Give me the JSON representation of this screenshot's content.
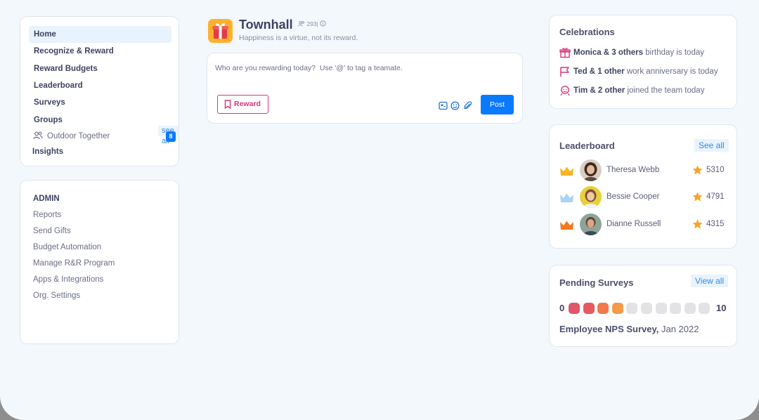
{
  "nav": {
    "items": [
      {
        "label": "Home",
        "active": true
      },
      {
        "label": "Recognize & Reward"
      },
      {
        "label": "Reward Budgets"
      },
      {
        "label": "Leaderboard"
      },
      {
        "label": "Surveys"
      },
      {
        "label": "Groups"
      }
    ],
    "groups_see_all": "see all",
    "group": {
      "label": "Outdoor Together",
      "count": "8"
    },
    "insights": "Insights"
  },
  "admin": {
    "title": "ADMIN",
    "links": [
      "Reports",
      "Send Gifts",
      "Budget Automation",
      "Manage R&R Program",
      "Apps & Integrations",
      "Org. Settings"
    ]
  },
  "townhall": {
    "title": "Townhall",
    "members": "293",
    "info_sep": "|",
    "subtitle": "Happiness is a virtue, not its reward."
  },
  "composer": {
    "placeholder": "Who are you rewarding today?  Use '@' to tag a teamate.",
    "reward_label": "Reward",
    "post_label": "Post",
    "tools": [
      "gif-icon",
      "emoji-icon",
      "attachment-icon"
    ]
  },
  "celebrations": {
    "title": "Celebrations",
    "items": [
      {
        "icon": "gift-icon",
        "who": "Monica & 3 others",
        "what": " birthday is today"
      },
      {
        "icon": "flag-icon",
        "who": "Ted & 1 other",
        "what": " work anniversary is today"
      },
      {
        "icon": "welcome-icon",
        "who": "Tim & 2 other",
        "what": " joined the team today"
      }
    ]
  },
  "leaderboard": {
    "title": "Leaderboard",
    "see_all": "See all",
    "entries": [
      {
        "name": "Theresa Webb",
        "points": "5310",
        "crown_color": "#f6b428"
      },
      {
        "name": "Bessie Cooper",
        "points": "4791",
        "crown_color": "#a9d3f5"
      },
      {
        "name": "Dianne Russell",
        "points": "4315",
        "crown_color": "#f0781e"
      }
    ]
  },
  "pending_surveys": {
    "title": "Pending Surveys",
    "view_all": "View all",
    "scale_min": "0",
    "scale_max": "10",
    "dot_colors": [
      "#e0566b",
      "#e5595f",
      "#f07a4c",
      "#f4984a",
      "#e3e3e6",
      "#e3e3e6",
      "#e3e3e6",
      "#e3e3e6",
      "#e3e3e6",
      "#e3e3e6"
    ],
    "survey_name": "Employee NPS Survey,",
    "survey_date": " Jan 2022"
  },
  "colors": {
    "accent": "#0a7aff",
    "reward": "#d9347a",
    "star": "#f6a623"
  }
}
